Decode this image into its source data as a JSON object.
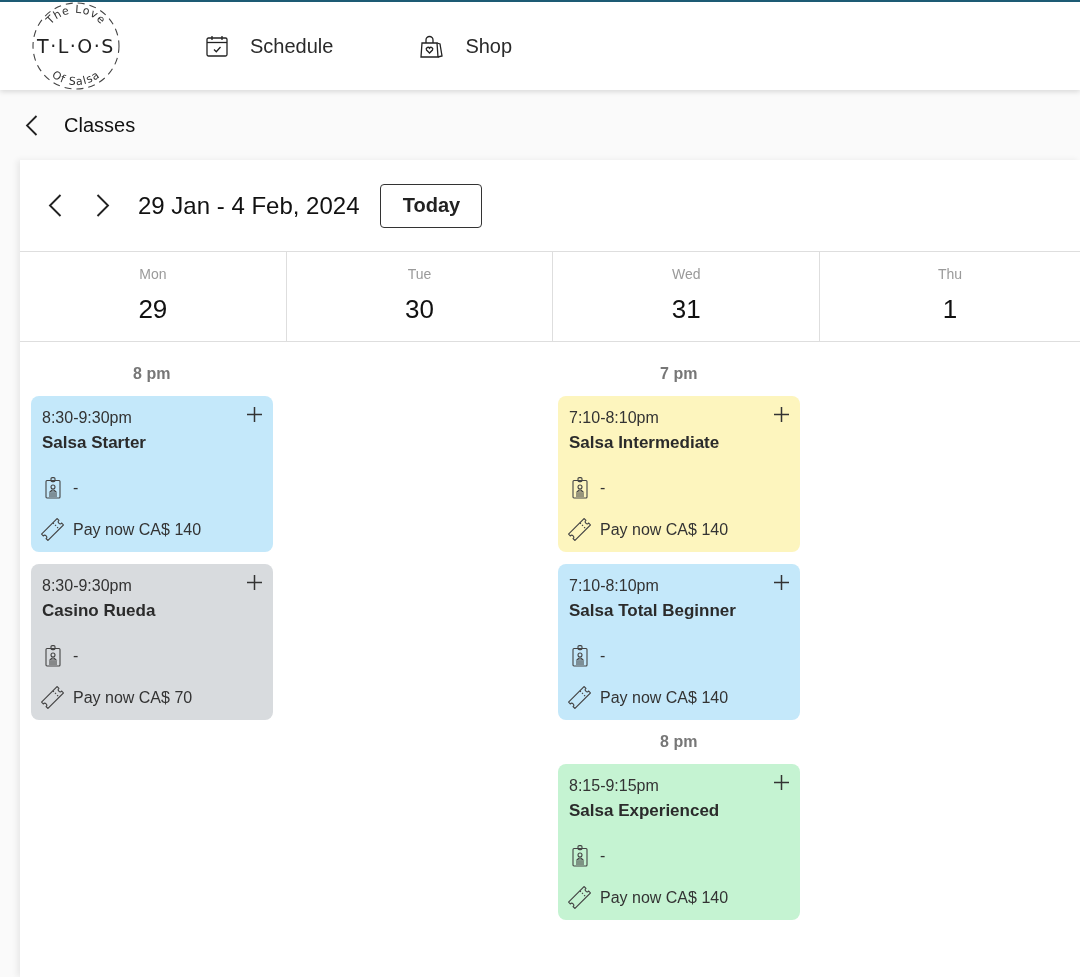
{
  "header": {
    "logo": {
      "top_text": "The Love",
      "initials": "T·L·O·S",
      "bottom_text": "Of Salsa"
    },
    "nav": [
      {
        "label": "Schedule"
      },
      {
        "label": "Shop"
      }
    ]
  },
  "breadcrumb": {
    "title": "Classes"
  },
  "calendar": {
    "range": "29 Jan - 4 Feb, 2024",
    "today_button": "Today",
    "days": [
      {
        "name": "Mon",
        "date": "29",
        "groups": [
          {
            "time": "8 pm",
            "events": [
              {
                "time": "8:30-9:30pm",
                "title": "Salsa Starter",
                "instructor": "-",
                "price": "Pay now CA$ 140",
                "color": "#c4e8fa"
              },
              {
                "time": "8:30-9:30pm",
                "title": "Casino Rueda",
                "instructor": "-",
                "price": "Pay now CA$ 70",
                "color": "#d8dbde"
              }
            ]
          }
        ]
      },
      {
        "name": "Tue",
        "date": "30"
      },
      {
        "name": "Wed",
        "date": "31",
        "groups": [
          {
            "time": "7 pm",
            "events": [
              {
                "time": "7:10-8:10pm",
                "title": "Salsa Intermediate",
                "instructor": "-",
                "price": "Pay now CA$ 140",
                "color": "#fdf5be"
              },
              {
                "time": "7:10-8:10pm",
                "title": "Salsa Total Beginner",
                "instructor": "-",
                "price": "Pay now CA$ 140",
                "color": "#c4e8fa"
              }
            ]
          },
          {
            "time": "8 pm",
            "events": [
              {
                "time": "8:15-9:15pm",
                "title": "Salsa Experienced",
                "instructor": "-",
                "price": "Pay now CA$ 140",
                "color": "#c5f3d2"
              }
            ]
          }
        ]
      },
      {
        "name": "Thu",
        "date": "1"
      }
    ]
  }
}
